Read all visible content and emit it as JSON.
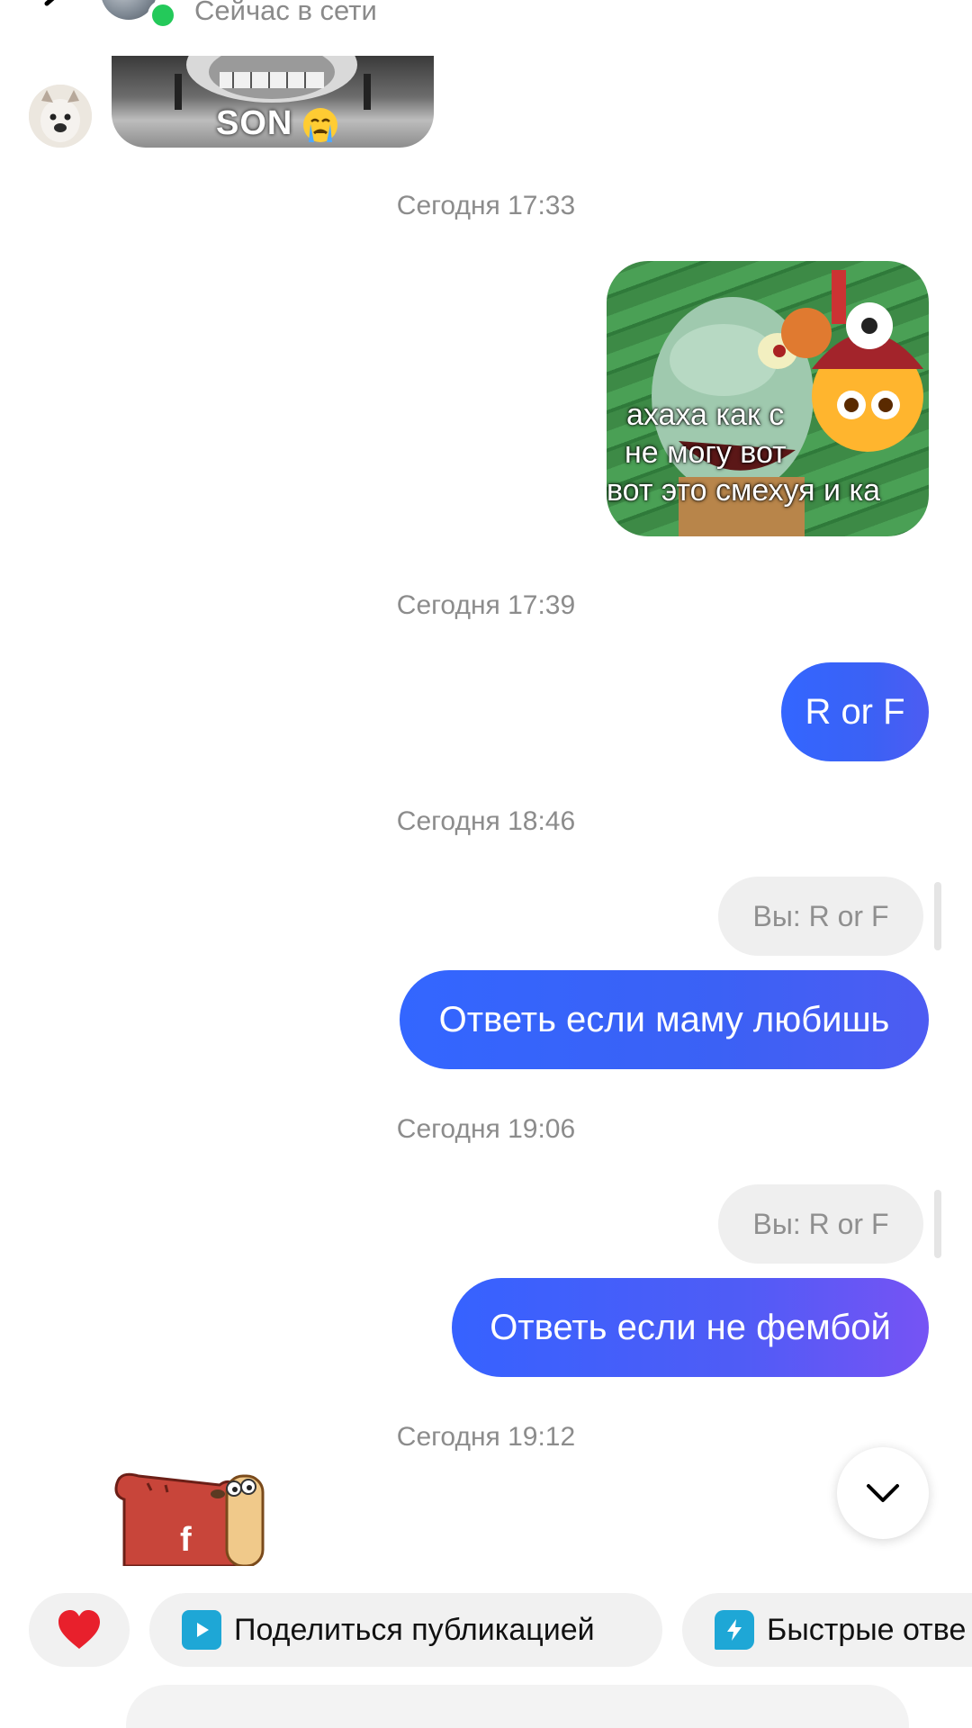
{
  "header": {
    "status": "Сейчас в сети",
    "colors": {
      "online": "#24c95a"
    }
  },
  "messages": {
    "skull_caption": "SON",
    "timestamps": [
      "Сегодня 17:33",
      "Сегодня 17:39",
      "Сегодня 18:46",
      "Сегодня 19:06",
      "Сегодня 19:12"
    ],
    "meme_lines": [
      "ахаха как с",
      "не могу вот",
      "вот это смехуя и ка"
    ],
    "bubble_r_or_f": "R or F",
    "reply_quote_1": "Вы: R or F",
    "bubble_mom": "Ответь если маму любишь",
    "reply_quote_2": "Вы: R or F",
    "bubble_femboy": "Ответь если не фембой",
    "sticker_letter": "f"
  },
  "actions": {
    "share_post": "Поделиться публикацией",
    "quick_replies": "Быстрые отве"
  },
  "icons": {
    "back": "back-arrow-icon",
    "heart": "heart-icon",
    "share": "play-share-icon",
    "quick": "lightning-icon",
    "scroll": "chevron-down-icon"
  },
  "colors": {
    "accent": "#3366ff",
    "bubble_gradient_end": "#7653f4",
    "heart": "#e8202c",
    "share_icon": "#1ea7d6"
  }
}
